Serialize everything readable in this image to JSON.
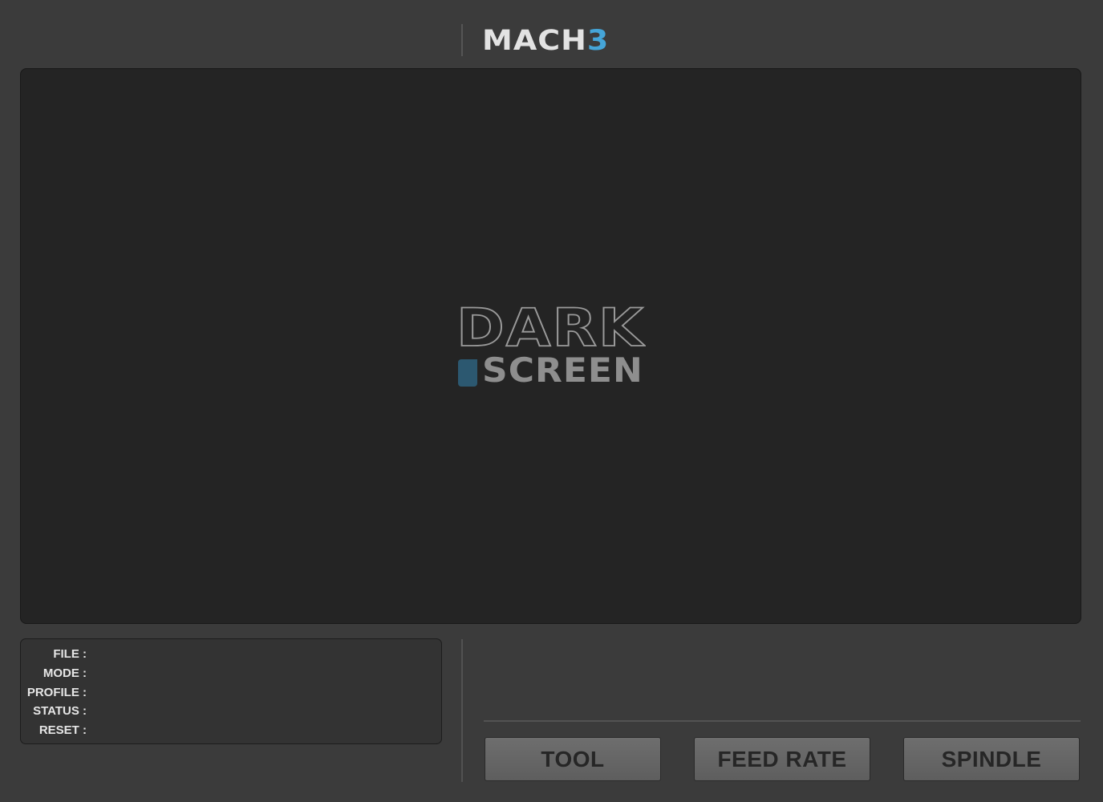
{
  "header": {
    "logo_main": "MACH",
    "logo_accent": "3"
  },
  "display": {
    "splash_top": "DARK",
    "splash_bottom": "SCREEN"
  },
  "info_panel": {
    "labels": [
      "FILE :",
      "MODE :",
      "PROFILE :",
      "STATUS :",
      "RESET :"
    ]
  },
  "buttons": {
    "tool": "TOOL",
    "feed_rate": "FEED RATE",
    "spindle": "SPINDLE"
  },
  "colors": {
    "background": "#3b3b3b",
    "display_bg": "#242424",
    "accent": "#45a5d8",
    "button": "#666666"
  }
}
